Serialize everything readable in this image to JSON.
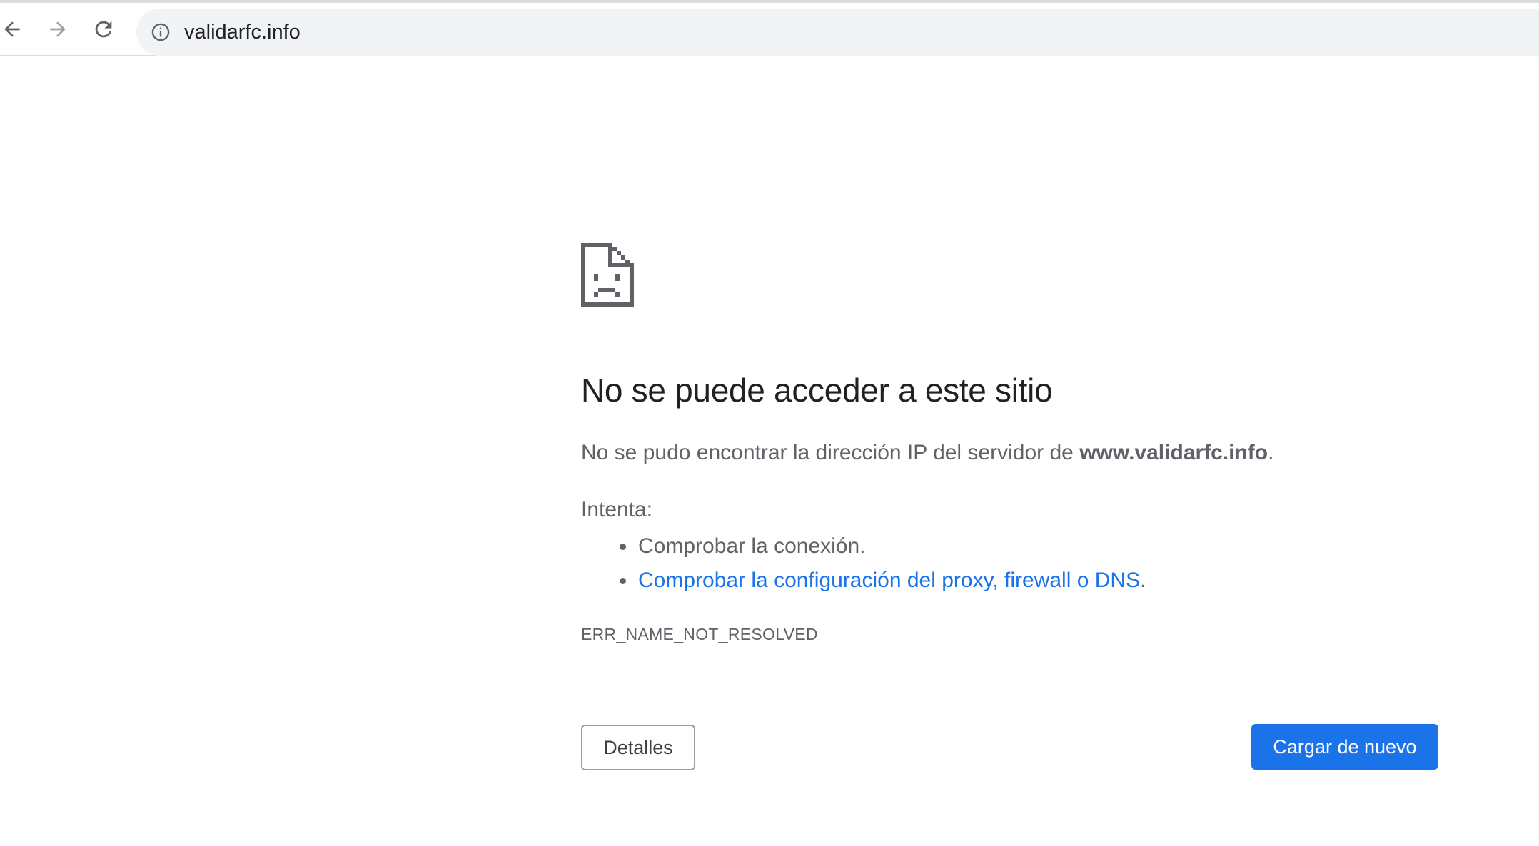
{
  "browser": {
    "url": "validarfc.info",
    "icons": {
      "back": "arrow-left-icon",
      "forward": "arrow-right-icon",
      "reload": "reload-icon",
      "site_info": "info-icon"
    }
  },
  "error_page": {
    "icon": "sad-document-icon",
    "heading": "No se puede acceder a este sitio",
    "summary_prefix": "No se pudo encontrar la dirección IP del servidor de ",
    "summary_host": "www.validarfc.info",
    "summary_suffix": ".",
    "try_label": "Intenta:",
    "suggestions": [
      {
        "text": "Comprobar la conexión.",
        "is_link": false
      },
      {
        "text": "Comprobar la configuración del proxy, firewall o DNS",
        "is_link": true,
        "suffix": "."
      }
    ],
    "error_code": "ERR_NAME_NOT_RESOLVED",
    "details_label": "Detalles",
    "reload_label": "Cargar de nuevo"
  },
  "colors": {
    "accent": "#1a73e8",
    "text_primary": "#202124",
    "text_secondary": "#5f6368",
    "omnibox_bg": "#f1f3f4"
  }
}
